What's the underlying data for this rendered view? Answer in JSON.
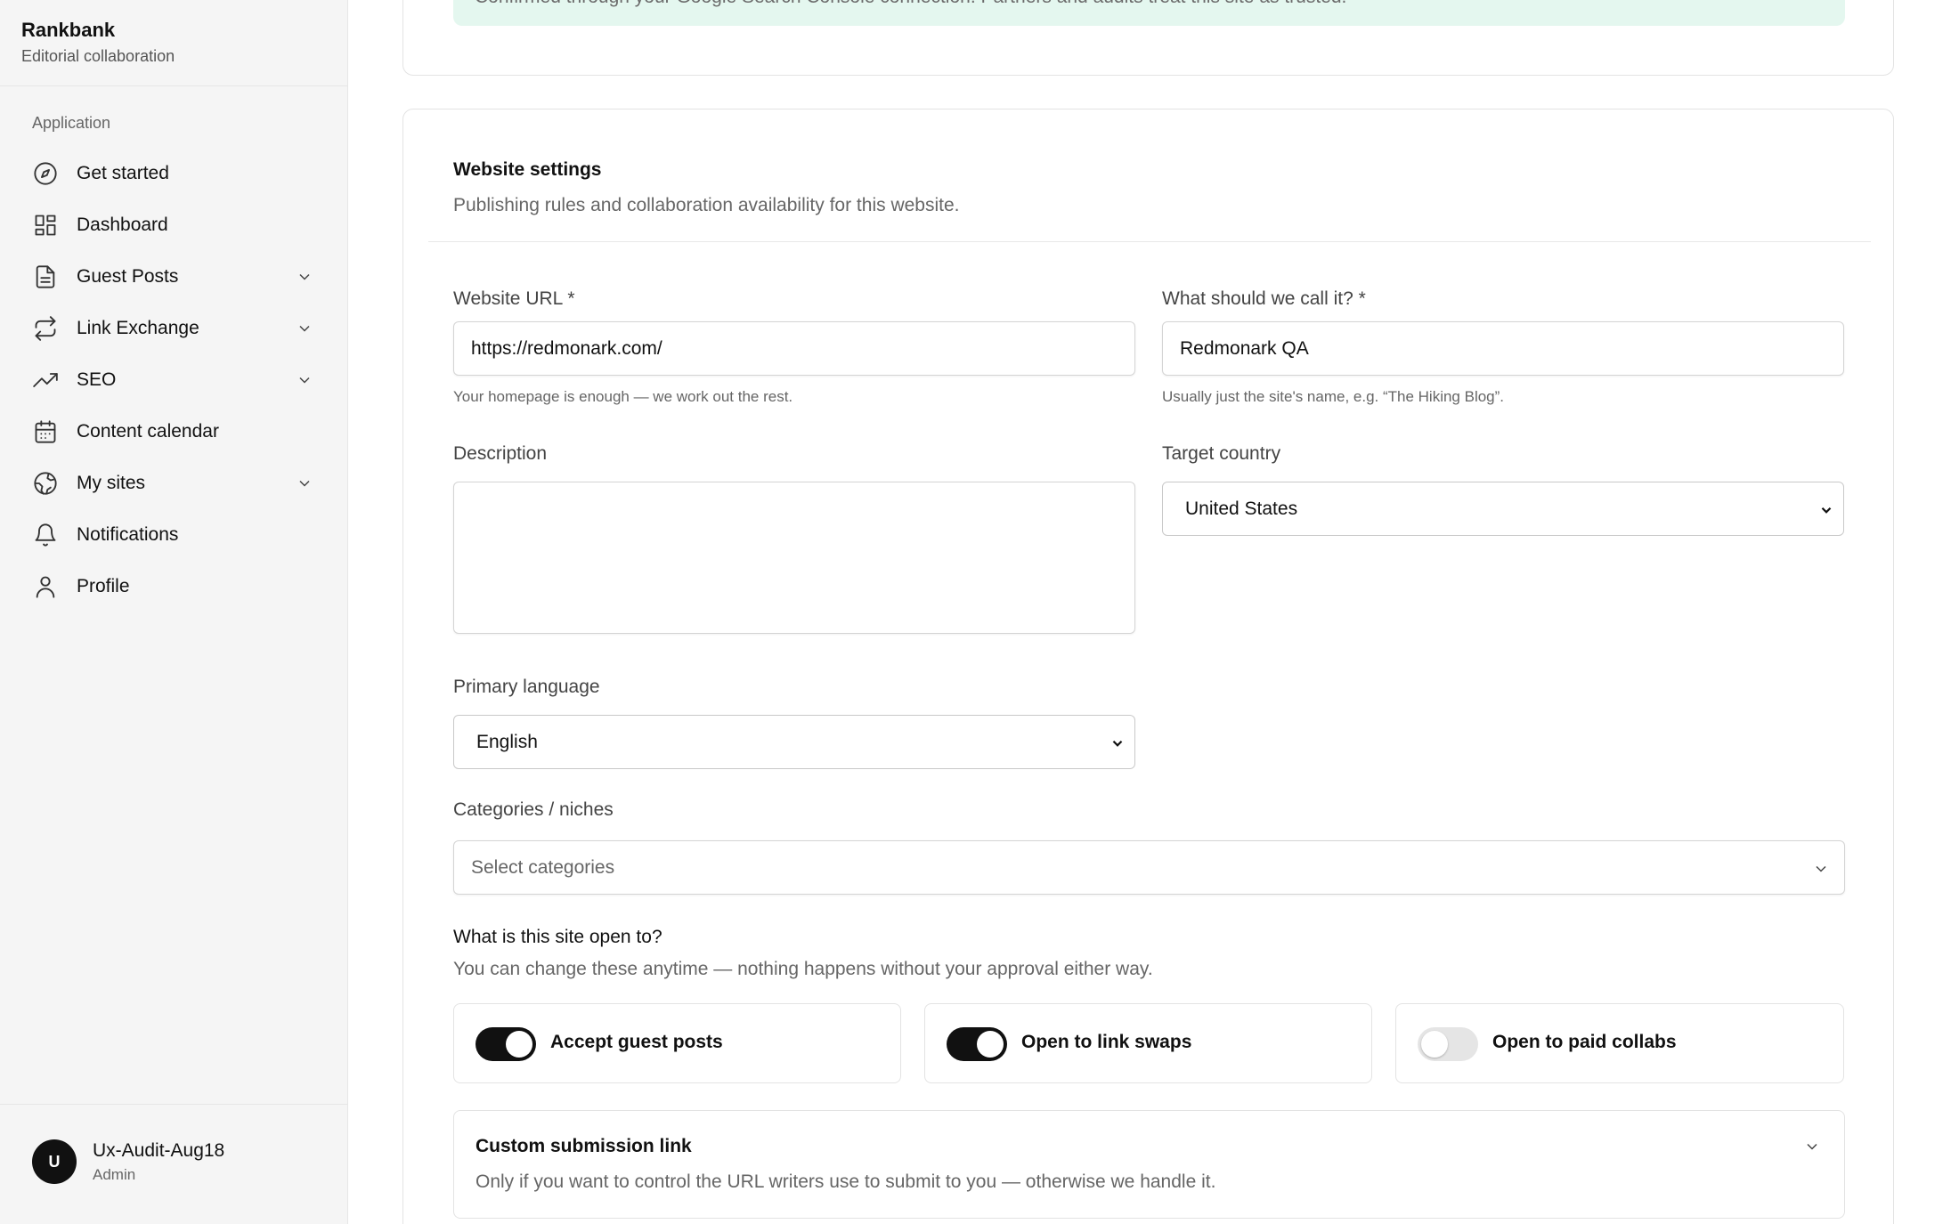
{
  "brand": {
    "name": "Rankbank",
    "subtitle": "Editorial collaboration"
  },
  "nav": {
    "section": "Application",
    "items": [
      {
        "label": "Get started",
        "icon": "compass-icon"
      },
      {
        "label": "Dashboard",
        "icon": "dashboard-icon"
      },
      {
        "label": "Guest Posts",
        "icon": "document-icon",
        "expandable": true
      },
      {
        "label": "Link Exchange",
        "icon": "repeat-icon",
        "expandable": true
      },
      {
        "label": "SEO",
        "icon": "trending-up-icon",
        "expandable": true
      },
      {
        "label": "Content calendar",
        "icon": "calendar-icon"
      },
      {
        "label": "My sites",
        "icon": "globe-icon",
        "expandable": true
      },
      {
        "label": "Notifications",
        "icon": "bell-icon"
      },
      {
        "label": "Profile",
        "icon": "user-icon"
      }
    ]
  },
  "user": {
    "initial": "U",
    "name": "Ux-Audit-Aug18",
    "role": "Admin"
  },
  "banner": {
    "text": "Confirmed through your Google Search Console connection. Partners and audits treat this site as trusted."
  },
  "settings": {
    "title": "Website settings",
    "subtitle": "Publishing rules and collaboration availability for this website.",
    "url": {
      "label": "Website URL *",
      "value": "https://redmonark.com/",
      "help": "Your homepage is enough — we work out the rest."
    },
    "name": {
      "label": "What should we call it? *",
      "value": "Redmonark QA",
      "help": "Usually just the site's name, e.g. “The Hiking Blog”."
    },
    "description": {
      "label": "Description",
      "value": ""
    },
    "country": {
      "label": "Target country",
      "value": "United States"
    },
    "language": {
      "label": "Primary language",
      "value": "English"
    },
    "categories": {
      "label": "Categories / niches",
      "placeholder": "Select categories"
    },
    "open_to": {
      "title": "What is this site open to?",
      "subtitle": "You can change these anytime — nothing happens without your approval either way.",
      "toggles": [
        {
          "label": "Accept guest posts",
          "on": true
        },
        {
          "label": "Open to link swaps",
          "on": true
        },
        {
          "label": "Open to paid collabs",
          "on": false
        }
      ]
    },
    "custom_link": {
      "title": "Custom submission link",
      "subtitle": "Only if you want to control the URL writers use to submit to you — otherwise we handle it."
    }
  },
  "colors": {
    "banner_bg": "#e4f7ef",
    "toggle_on": "#111111",
    "toggle_off": "#e5e5e5"
  }
}
